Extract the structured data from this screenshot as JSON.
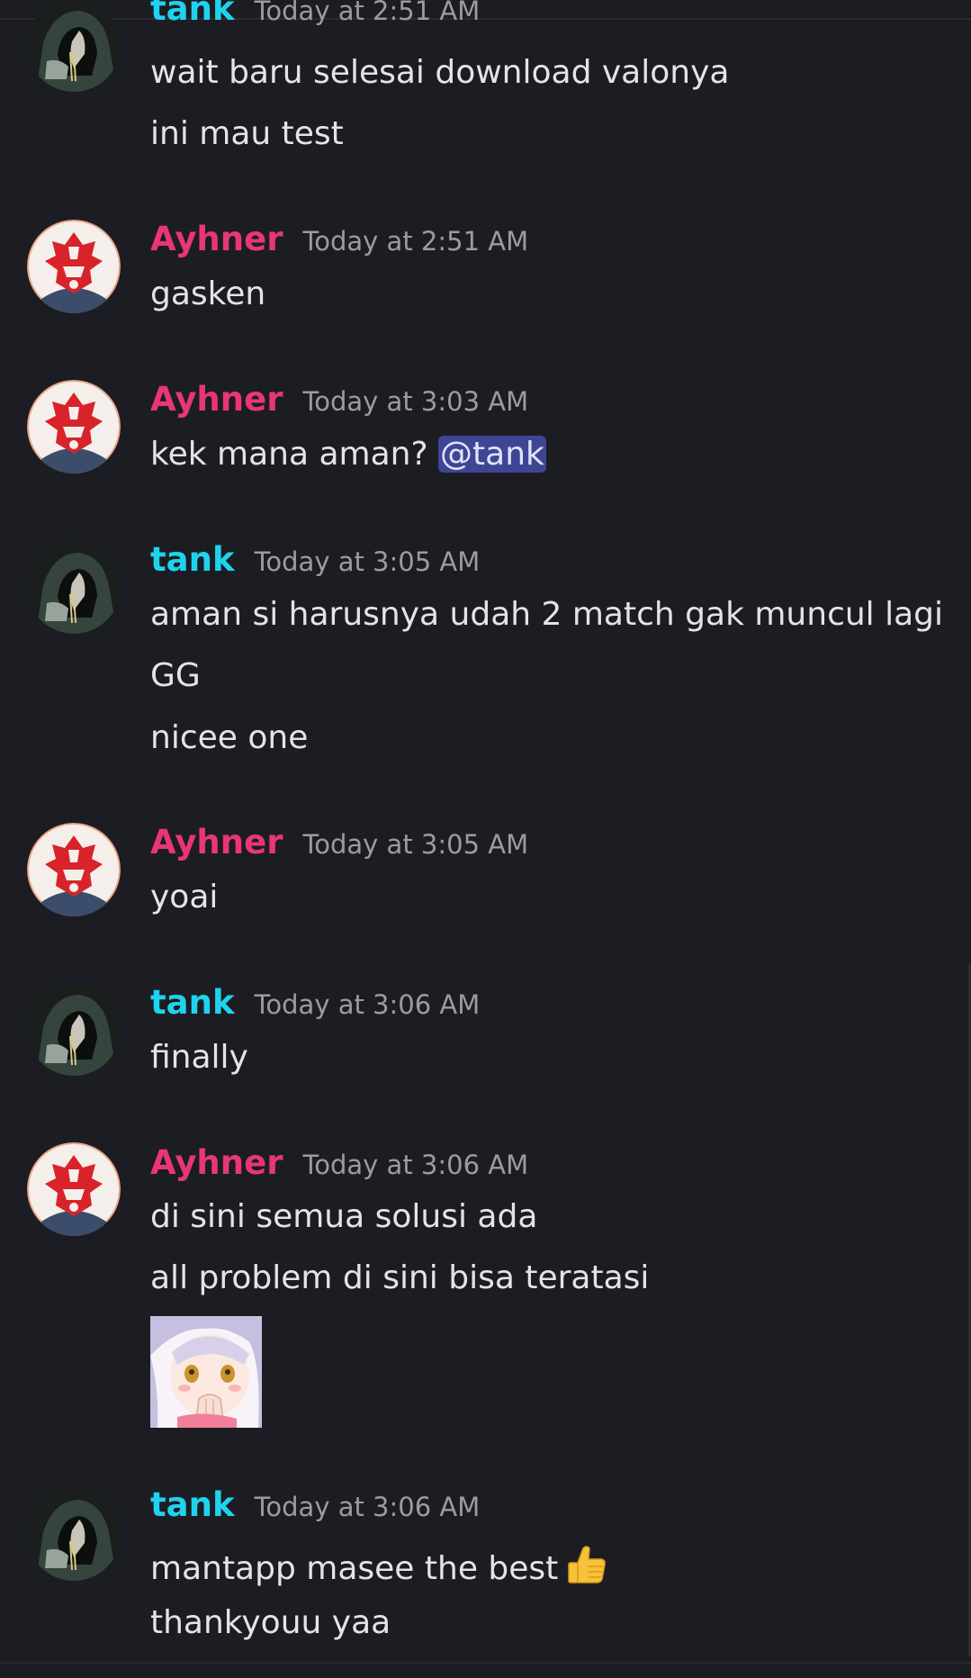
{
  "colors": {
    "background": "#1c1d22",
    "tank_name": "#1fd3ef",
    "ayhner_name": "#e9357a",
    "timestamp": "#9b9ca3",
    "text": "#e3e4e8",
    "mention_bg": "#3e4694"
  },
  "messages": [
    {
      "author": "tank",
      "timestamp": "Today at 2:51 AM",
      "avatar_icon": "hooded-character-avatar-icon",
      "lines": [
        "wait baru selesai download valonya",
        "ini mau test"
      ]
    },
    {
      "author": "Ayhner",
      "timestamp": "Today at 2:51 AM",
      "avatar_icon": "red-samurai-helmet-avatar-icon",
      "lines": [
        "gasken"
      ]
    },
    {
      "author": "Ayhner",
      "timestamp": "Today at 3:03 AM",
      "avatar_icon": "red-samurai-helmet-avatar-icon",
      "lines": [
        "kek mana aman?"
      ],
      "mention": "@tank"
    },
    {
      "author": "tank",
      "timestamp": "Today at 3:05 AM",
      "avatar_icon": "hooded-character-avatar-icon",
      "lines": [
        "aman si harusnya udah 2 match gak muncul lagi",
        "GG",
        "nicee one"
      ]
    },
    {
      "author": "Ayhner",
      "timestamp": "Today at 3:05 AM",
      "avatar_icon": "red-samurai-helmet-avatar-icon",
      "lines": [
        "yoai"
      ]
    },
    {
      "author": "tank",
      "timestamp": "Today at 3:06 AM",
      "avatar_icon": "hooded-character-avatar-icon",
      "lines": [
        "finally"
      ]
    },
    {
      "author": "Ayhner",
      "timestamp": "Today at 3:06 AM",
      "avatar_icon": "red-samurai-helmet-avatar-icon",
      "lines": [
        "di sini semua solusi ada",
        "all problem di sini bisa teratasi"
      ],
      "sticker_icon": "anime-girl-sticker-icon"
    },
    {
      "author": "tank",
      "timestamp": "Today at 3:06 AM",
      "avatar_icon": "hooded-character-avatar-icon",
      "lines": [
        "mantapp masee the best",
        "thankyouu yaa"
      ],
      "emoji_icon": "thumbs-up-icon"
    }
  ]
}
